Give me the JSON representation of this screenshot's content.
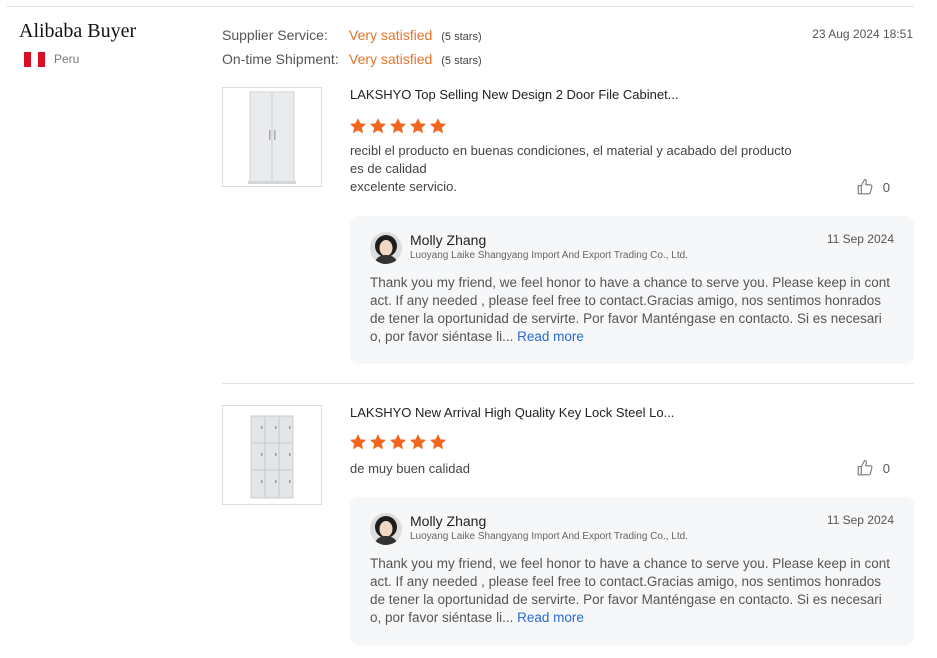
{
  "buyer": {
    "name": "Alibaba Buyer",
    "country": "Peru",
    "flag_colors": [
      "#d91023",
      "#ffffff",
      "#d91023"
    ]
  },
  "ratings": [
    {
      "label": "Supplier Service:",
      "value": "Very satisfied",
      "stars": "(5 stars)"
    },
    {
      "label": "On-time Shipment:",
      "value": "Very satisfied",
      "stars": "(5 stars)"
    }
  ],
  "review_date": "23 Aug 2024 18:51",
  "accent_color": "#f0661e",
  "reviews": [
    {
      "product_title": "LAKSHYO Top Selling New Design 2 Door File Cabinet...",
      "rating": 5,
      "comment": "recibl el producto en buenas condiciones, el material y acabado del producto es de calidad\nexcelente servicio.",
      "likes": "0",
      "reply": {
        "name": "Molly Zhang",
        "company": "Luoyang Laike Shangyang Import And Export Trading Co., Ltd.",
        "date": "11 Sep 2024",
        "text": "Thank you my friend, we feel honor to have a chance to serve you. Please keep in contact. If any needed , please feel free to contact.Gracias amigo, nos sentimos honrados de tener la oportunidad de servirte. Por favor Manténgase en contacto. Si es necesario, por favor siéntase li...",
        "read_more": "Read more"
      }
    },
    {
      "product_title": "LAKSHYO New Arrival High Quality Key Lock Steel Lo...",
      "rating": 5,
      "comment": "de muy buen calidad",
      "likes": "0",
      "reply": {
        "name": "Molly Zhang",
        "company": "Luoyang Laike Shangyang Import And Export Trading Co., Ltd.",
        "date": "11 Sep 2024",
        "text": "Thank you my friend, we feel honor to have a chance to serve you. Please keep in contact. If any needed , please feel free to contact.Gracias amigo, nos sentimos honrados de tener la oportunidad de servirte. Por favor Manténgase en contacto. Si es necesario, por favor siéntase li...",
        "read_more": "Read more"
      }
    }
  ]
}
